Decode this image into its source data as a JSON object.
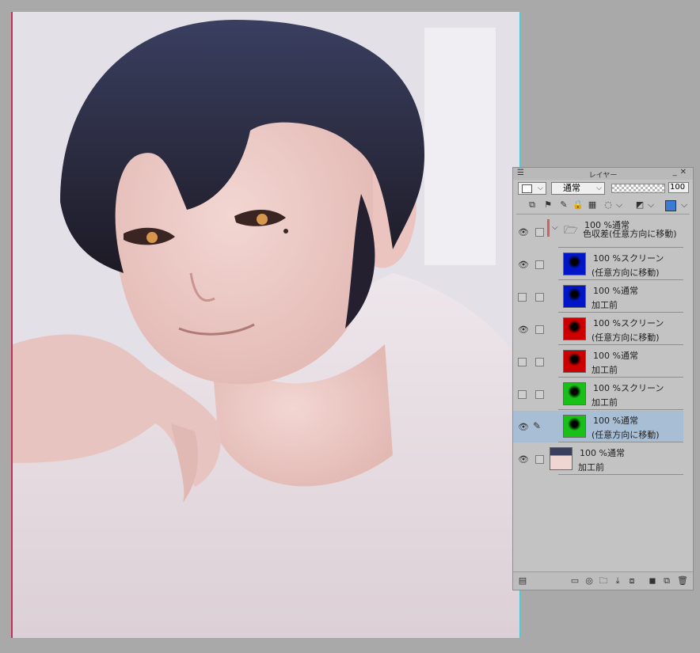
{
  "panel": {
    "title": "レイヤー",
    "blend_mode": "通常",
    "opacity": "100",
    "menu_icon": "hamburger-icon",
    "minimize": "_",
    "close": "✕"
  },
  "layers": [
    {
      "type": "folder",
      "visible": true,
      "line1": "100 %通常",
      "line2": "色収差(任意方向に移動)",
      "thumb": "folder-icon",
      "color": "#d06060"
    },
    {
      "type": "layer",
      "visible": true,
      "line1": "100 %スクリーン",
      "line2": "(任意方向に移動)",
      "thumb_color": "#0016c8"
    },
    {
      "type": "layer",
      "visible": false,
      "line1": "100 %通常",
      "line2": "加工前",
      "thumb_color": "#0016c8"
    },
    {
      "type": "layer",
      "visible": true,
      "line1": "100 %スクリーン",
      "line2": "(任意方向に移動)",
      "thumb_color": "#cc0000"
    },
    {
      "type": "layer",
      "visible": false,
      "line1": "100 %通常",
      "line2": "加工前",
      "thumb_color": "#cc0000"
    },
    {
      "type": "layer",
      "visible": false,
      "line1": "100 %スクリーン",
      "line2": "加工前",
      "thumb_color": "#18c018"
    },
    {
      "type": "layer",
      "visible": true,
      "selected": true,
      "line1": "100 %通常",
      "line2": "(任意方向に移動)",
      "thumb_color": "#18c018"
    },
    {
      "type": "layer",
      "visible": true,
      "line1": "100 %通常",
      "line2": "加工前",
      "thumb_color": "#e8d8d8"
    }
  ],
  "colors": {
    "canvas_bg": "#e6e2ea",
    "panel_bg": "#c3c3c3",
    "selected_row": "#a8bed5"
  }
}
